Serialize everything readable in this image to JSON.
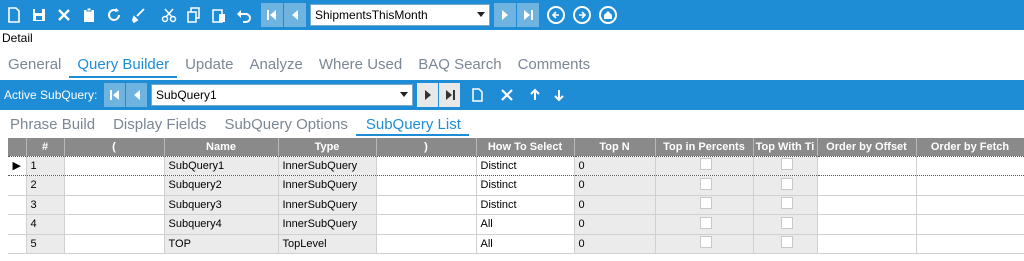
{
  "toolbar": {
    "icons": [
      "new-icon",
      "save-icon",
      "delete-icon",
      "clipboard-icon",
      "refresh-icon",
      "clear-icon",
      "cut-icon",
      "copy-icon",
      "paste-icon",
      "undo-icon"
    ],
    "query_combo": "ShipmentsThisMonth"
  },
  "detail_label": "Detail",
  "main_tabs": [
    "General",
    "Query Builder",
    "Update",
    "Analyze",
    "Where Used",
    "BAQ Search",
    "Comments"
  ],
  "active_main_tab": "Query Builder",
  "subquery_bar": {
    "label": "Active SubQuery:",
    "combo": "SubQuery1"
  },
  "sub_tabs": [
    "Phrase Build",
    "Display Fields",
    "SubQuery Options",
    "SubQuery List"
  ],
  "active_sub_tab": "SubQuery List",
  "grid": {
    "columns": [
      "#",
      "(",
      "Name",
      "Type",
      ")",
      "How To Select",
      "Top N",
      "Top in Percents",
      "Top With Ti",
      "Order by Offset",
      "Order by Fetch"
    ],
    "rows": [
      {
        "num": "1",
        "open": "",
        "name": "SubQuery1",
        "type": "InnerSubQuery",
        "close": "",
        "how": "Distinct",
        "topn": "0"
      },
      {
        "num": "2",
        "open": "",
        "name": "Subquery2",
        "type": "InnerSubQuery",
        "close": "",
        "how": "Distinct",
        "topn": "0"
      },
      {
        "num": "3",
        "open": "",
        "name": "Subquery3",
        "type": "InnerSubQuery",
        "close": "",
        "how": "Distinct",
        "topn": "0"
      },
      {
        "num": "4",
        "open": "",
        "name": "Subquery4",
        "type": "InnerSubQuery",
        "close": "",
        "how": "All",
        "topn": "0"
      },
      {
        "num": "5",
        "open": "",
        "name": "TOP",
        "type": "TopLevel",
        "close": "",
        "how": "All",
        "topn": "0"
      }
    ]
  },
  "colors": {
    "accent": "#1f8dd6",
    "header_gray": "#8a8a8a"
  }
}
